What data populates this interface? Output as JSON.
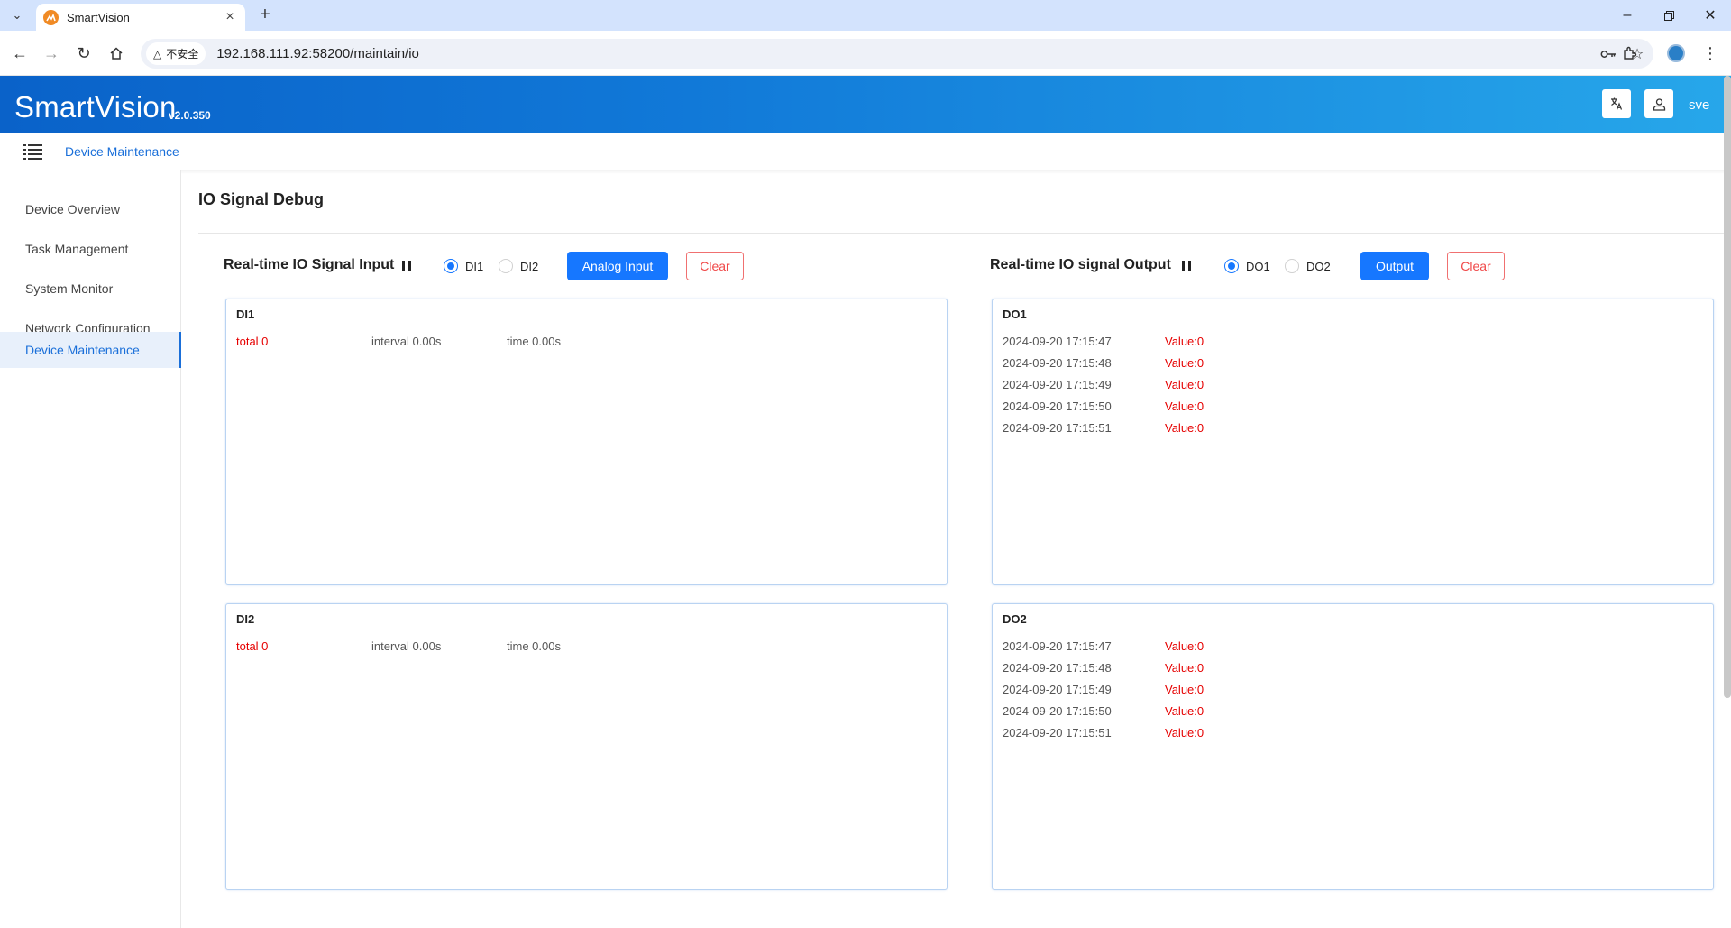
{
  "browser": {
    "tab_title": "SmartVision",
    "security_label": "不安全",
    "url": "192.168.111.92:58200/maintain/io"
  },
  "app": {
    "brand": "SmartVision",
    "version": "v2.0.350",
    "user": "sve"
  },
  "breadcrumb": "Device Maintenance",
  "sidebar": {
    "items": [
      {
        "label": "Device Overview",
        "active": false
      },
      {
        "label": "Task Management",
        "active": false
      },
      {
        "label": "System Monitor",
        "active": false
      },
      {
        "label": "Network Configuration",
        "active": false
      },
      {
        "label": "Device Maintenance",
        "active": true
      }
    ]
  },
  "page": {
    "title": "IO Signal Debug"
  },
  "input": {
    "title": "Real-time IO Signal Input",
    "radio_1": "DI1",
    "radio_2": "DI2",
    "selected": "DI1",
    "analog_button": "Analog Input",
    "clear_button": "Clear",
    "panels": [
      {
        "title": "DI1",
        "total": "total 0",
        "interval": "interval 0.00s",
        "time": "time 0.00s"
      },
      {
        "title": "DI2",
        "total": "total 0",
        "interval": "interval 0.00s",
        "time": "time 0.00s"
      }
    ]
  },
  "output": {
    "title": "Real-time IO signal Output",
    "radio_1": "DO1",
    "radio_2": "DO2",
    "selected": "DO1",
    "output_button": "Output",
    "clear_button": "Clear",
    "panels": [
      {
        "title": "DO1",
        "rows": [
          {
            "time": "2024-09-20 17:15:47",
            "value": "Value:0"
          },
          {
            "time": "2024-09-20 17:15:48",
            "value": "Value:0"
          },
          {
            "time": "2024-09-20 17:15:49",
            "value": "Value:0"
          },
          {
            "time": "2024-09-20 17:15:50",
            "value": "Value:0"
          },
          {
            "time": "2024-09-20 17:15:51",
            "value": "Value:0"
          }
        ]
      },
      {
        "title": "DO2",
        "rows": [
          {
            "time": "2024-09-20 17:15:47",
            "value": "Value:0"
          },
          {
            "time": "2024-09-20 17:15:48",
            "value": "Value:0"
          },
          {
            "time": "2024-09-20 17:15:49",
            "value": "Value:0"
          },
          {
            "time": "2024-09-20 17:15:50",
            "value": "Value:0"
          },
          {
            "time": "2024-09-20 17:15:51",
            "value": "Value:0"
          }
        ]
      }
    ]
  },
  "colors": {
    "accent": "#1677ff",
    "danger": "#e60000",
    "header_start": "#0a62c9",
    "header_end": "#27a7ea"
  }
}
